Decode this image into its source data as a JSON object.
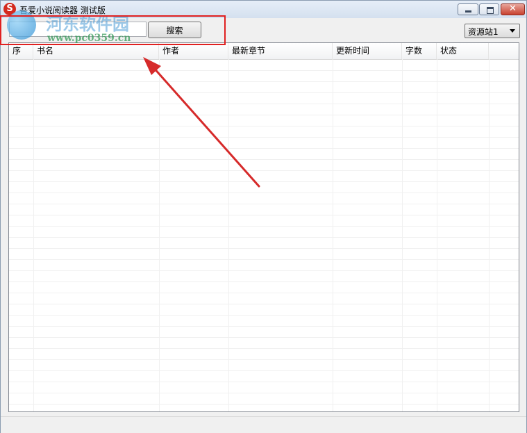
{
  "window": {
    "app_icon_letter": "S",
    "title": "吾爱小说阅读器 测试版",
    "controls": {
      "minimize": "minimize-icon",
      "maximize": "maximize-icon",
      "close": "close-icon"
    }
  },
  "toolbar": {
    "search_value": "",
    "search_button_label": "搜索",
    "source_select": {
      "selected": "资源站1"
    }
  },
  "table": {
    "columns": [
      {
        "label": "序"
      },
      {
        "label": "书名"
      },
      {
        "label": "作者"
      },
      {
        "label": "最新章节"
      },
      {
        "label": "更新时间"
      },
      {
        "label": "字数"
      },
      {
        "label": "状态"
      }
    ],
    "rows": []
  },
  "watermark": {
    "title": "河东软件园",
    "url": "www.pc0359.cn"
  },
  "annotation": {
    "highlight_color": "#e02020",
    "arrow_color": "#d62a2a"
  }
}
